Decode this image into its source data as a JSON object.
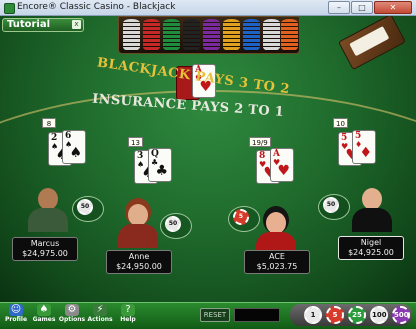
{
  "window": {
    "title": "Encore® Classic Casino - Blackjack",
    "buttons": {
      "minimize": "–",
      "maximize": "□",
      "close": "✕"
    }
  },
  "tutorial": {
    "label": "Tutorial",
    "close": "x"
  },
  "tray": {
    "chips": [
      {
        "color": "#d8d8d8"
      },
      {
        "color": "#c62828"
      },
      {
        "color": "#1e8e3e"
      },
      {
        "color": "#222222"
      },
      {
        "color": "#7b2a9e"
      },
      {
        "color": "#e0a020"
      },
      {
        "color": "#1e62c8"
      },
      {
        "color": "#d8d8d8"
      },
      {
        "color": "#e06020"
      }
    ]
  },
  "dealer": {
    "cards": [
      {
        "rank": "A",
        "suit": "♥",
        "color": "red"
      }
    ]
  },
  "felt": {
    "line1": "BLACKJACK PAYS 3 TO 2",
    "line2": "INSURANCE PAYS 2 TO 1"
  },
  "hands": [
    {
      "score": "8",
      "cards": [
        {
          "rank": "2",
          "suit": "♠",
          "color": "blk"
        },
        {
          "rank": "6",
          "suit": "♠",
          "color": "blk"
        }
      ],
      "bet": "50"
    },
    {
      "score": "13",
      "cards": [
        {
          "rank": "3",
          "suit": "♠",
          "color": "blk"
        },
        {
          "rank": "Q",
          "suit": "♣",
          "color": "blk"
        }
      ],
      "bet": "50"
    },
    {
      "score": "19/9",
      "cards": [
        {
          "rank": "8",
          "suit": "♥",
          "color": "red"
        },
        {
          "rank": "A",
          "suit": "♥",
          "color": "red"
        }
      ],
      "bet": "5"
    },
    {
      "score": "10",
      "cards": [
        {
          "rank": "5",
          "suit": "♥",
          "color": "red"
        },
        {
          "rank": "5",
          "suit": "♦",
          "color": "red"
        }
      ],
      "bet": "50"
    }
  ],
  "players": [
    {
      "name": "Marcus",
      "money": "$24,975.00"
    },
    {
      "name": "Anne",
      "money": "$24,950.00"
    },
    {
      "name": "ACE",
      "money": "$5,023.75"
    },
    {
      "name": "Nigel",
      "money": "$24,925.00"
    }
  ],
  "bottom": {
    "nav": [
      {
        "label": "Profile",
        "icon": "profile-icon"
      },
      {
        "label": "Games",
        "icon": "games-icon"
      },
      {
        "label": "Options",
        "icon": "options-icon"
      },
      {
        "label": "Actions",
        "icon": "actions-icon"
      },
      {
        "label": "Help",
        "icon": "help-icon"
      }
    ],
    "reset": "RESET",
    "chips": [
      {
        "value": "1",
        "color": "#e8e8e8"
      },
      {
        "value": "5",
        "color": "#d63a2a"
      },
      {
        "value": "25",
        "color": "#2a9a3a"
      },
      {
        "value": "100",
        "color": "#e8e8e8"
      },
      {
        "value": "500",
        "color": "#8a3ab0"
      }
    ]
  }
}
